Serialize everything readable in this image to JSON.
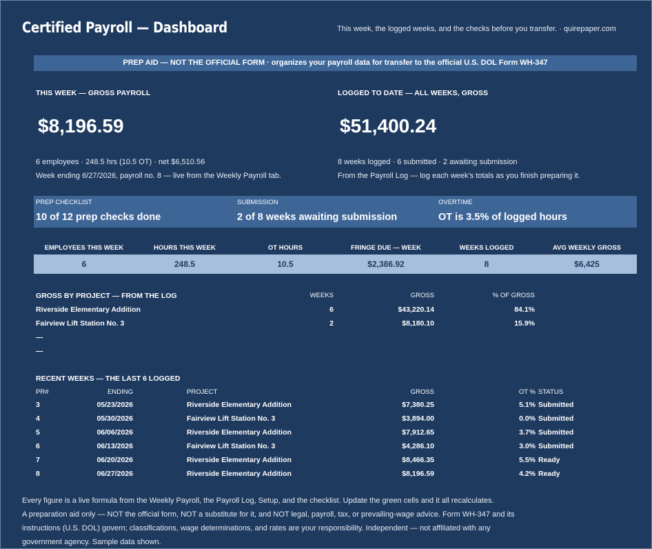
{
  "header": {
    "title": "Certified Payroll — Dashboard",
    "tagline": "This week, the logged weeks, and the checks before you transfer.  ·  quirepaper.com"
  },
  "banner": "PREP AID — NOT THE OFFICIAL FORM  ·  organizes your payroll data for transfer to the official U.S. DOL Form WH-347",
  "this_week": {
    "label": "THIS WEEK — GROSS PAYROLL",
    "value": "$8,196.59",
    "sub1": "6 employees  ·  248.5 hrs (10.5 OT)  ·  net $6,510.56",
    "sub2": "Week ending 6/27/2026, payroll no. 8 — live from the Weekly Payroll tab."
  },
  "logged": {
    "label": "LOGGED TO DATE — ALL WEEKS, GROSS",
    "value": "$51,400.24",
    "sub1": "8 weeks logged  ·  6 submitted  ·  2 awaiting submission",
    "sub2": "From the Payroll Log — log each week's totals as you finish preparing it."
  },
  "status": [
    {
      "label": "PREP CHECKLIST",
      "value": "10 of 12 prep checks done"
    },
    {
      "label": "SUBMISSION",
      "value": "2 of 8 weeks awaiting submission"
    },
    {
      "label": "OVERTIME",
      "value": "OT is 3.5% of logged hours"
    }
  ],
  "stats": [
    {
      "label": "EMPLOYEES THIS WEEK",
      "value": "6"
    },
    {
      "label": "HOURS THIS WEEK",
      "value": "248.5"
    },
    {
      "label": "OT HOURS",
      "value": "10.5"
    },
    {
      "label": "FRINGE DUE — WEEK",
      "value": "$2,386.92"
    },
    {
      "label": "WEEKS LOGGED",
      "value": "8"
    },
    {
      "label": "AVG WEEKLY GROSS",
      "value": "$6,425"
    }
  ],
  "projects": {
    "title": "GROSS BY PROJECT — FROM THE LOG",
    "headers": {
      "weeks": "WEEKS",
      "gross": "GROSS",
      "pct": "% OF GROSS"
    },
    "rows": [
      {
        "name": "Riverside Elementary Addition",
        "weeks": "6",
        "gross": "$43,220.14",
        "pct": "84.1%"
      },
      {
        "name": "Fairview Lift Station No. 3",
        "weeks": "2",
        "gross": "$8,180.10",
        "pct": "15.9%"
      },
      {
        "name": "—",
        "weeks": "",
        "gross": "",
        "pct": ""
      },
      {
        "name": "—",
        "weeks": "",
        "gross": "",
        "pct": ""
      }
    ]
  },
  "recent": {
    "title": "RECENT WEEKS — THE LAST 6 LOGGED",
    "headers": {
      "pr": "PR#",
      "ending": "ENDING",
      "project": "PROJECT",
      "gross": "GROSS",
      "ot": "OT %",
      "status": "STATUS"
    },
    "rows": [
      {
        "pr": "3",
        "ending": "05/23/2026",
        "project": "Riverside Elementary Addition",
        "gross": "$7,380.25",
        "ot": "5.1%",
        "status": "Submitted"
      },
      {
        "pr": "4",
        "ending": "05/30/2026",
        "project": "Fairview Lift Station No. 3",
        "gross": "$3,894.00",
        "ot": "0.0%",
        "status": "Submitted"
      },
      {
        "pr": "5",
        "ending": "06/06/2026",
        "project": "Riverside Elementary Addition",
        "gross": "$7,912.65",
        "ot": "3.7%",
        "status": "Submitted"
      },
      {
        "pr": "6",
        "ending": "06/13/2026",
        "project": "Fairview Lift Station No. 3",
        "gross": "$4,286.10",
        "ot": "3.0%",
        "status": "Submitted"
      },
      {
        "pr": "7",
        "ending": "06/20/2026",
        "project": "Riverside Elementary Addition",
        "gross": "$8,466.35",
        "ot": "5.5%",
        "status": "Ready"
      },
      {
        "pr": "8",
        "ending": "06/27/2026",
        "project": "Riverside Elementary Addition",
        "gross": "$8,196.59",
        "ot": "4.2%",
        "status": "Ready"
      }
    ]
  },
  "footer": [
    "Every figure is a live formula from the Weekly Payroll, the Payroll Log, Setup, and the checklist. Update the green cells and it all recalculates.",
    "A preparation aid only — NOT the official form, NOT a substitute for it, and NOT legal, payroll, tax, or prevailing-wage advice. Form WH-347 and its",
    "instructions (U.S. DOL) govern; classifications, wage determinations, and rates are your responsibility. Independent — not affiliated with any",
    "government agency. Sample data shown."
  ]
}
